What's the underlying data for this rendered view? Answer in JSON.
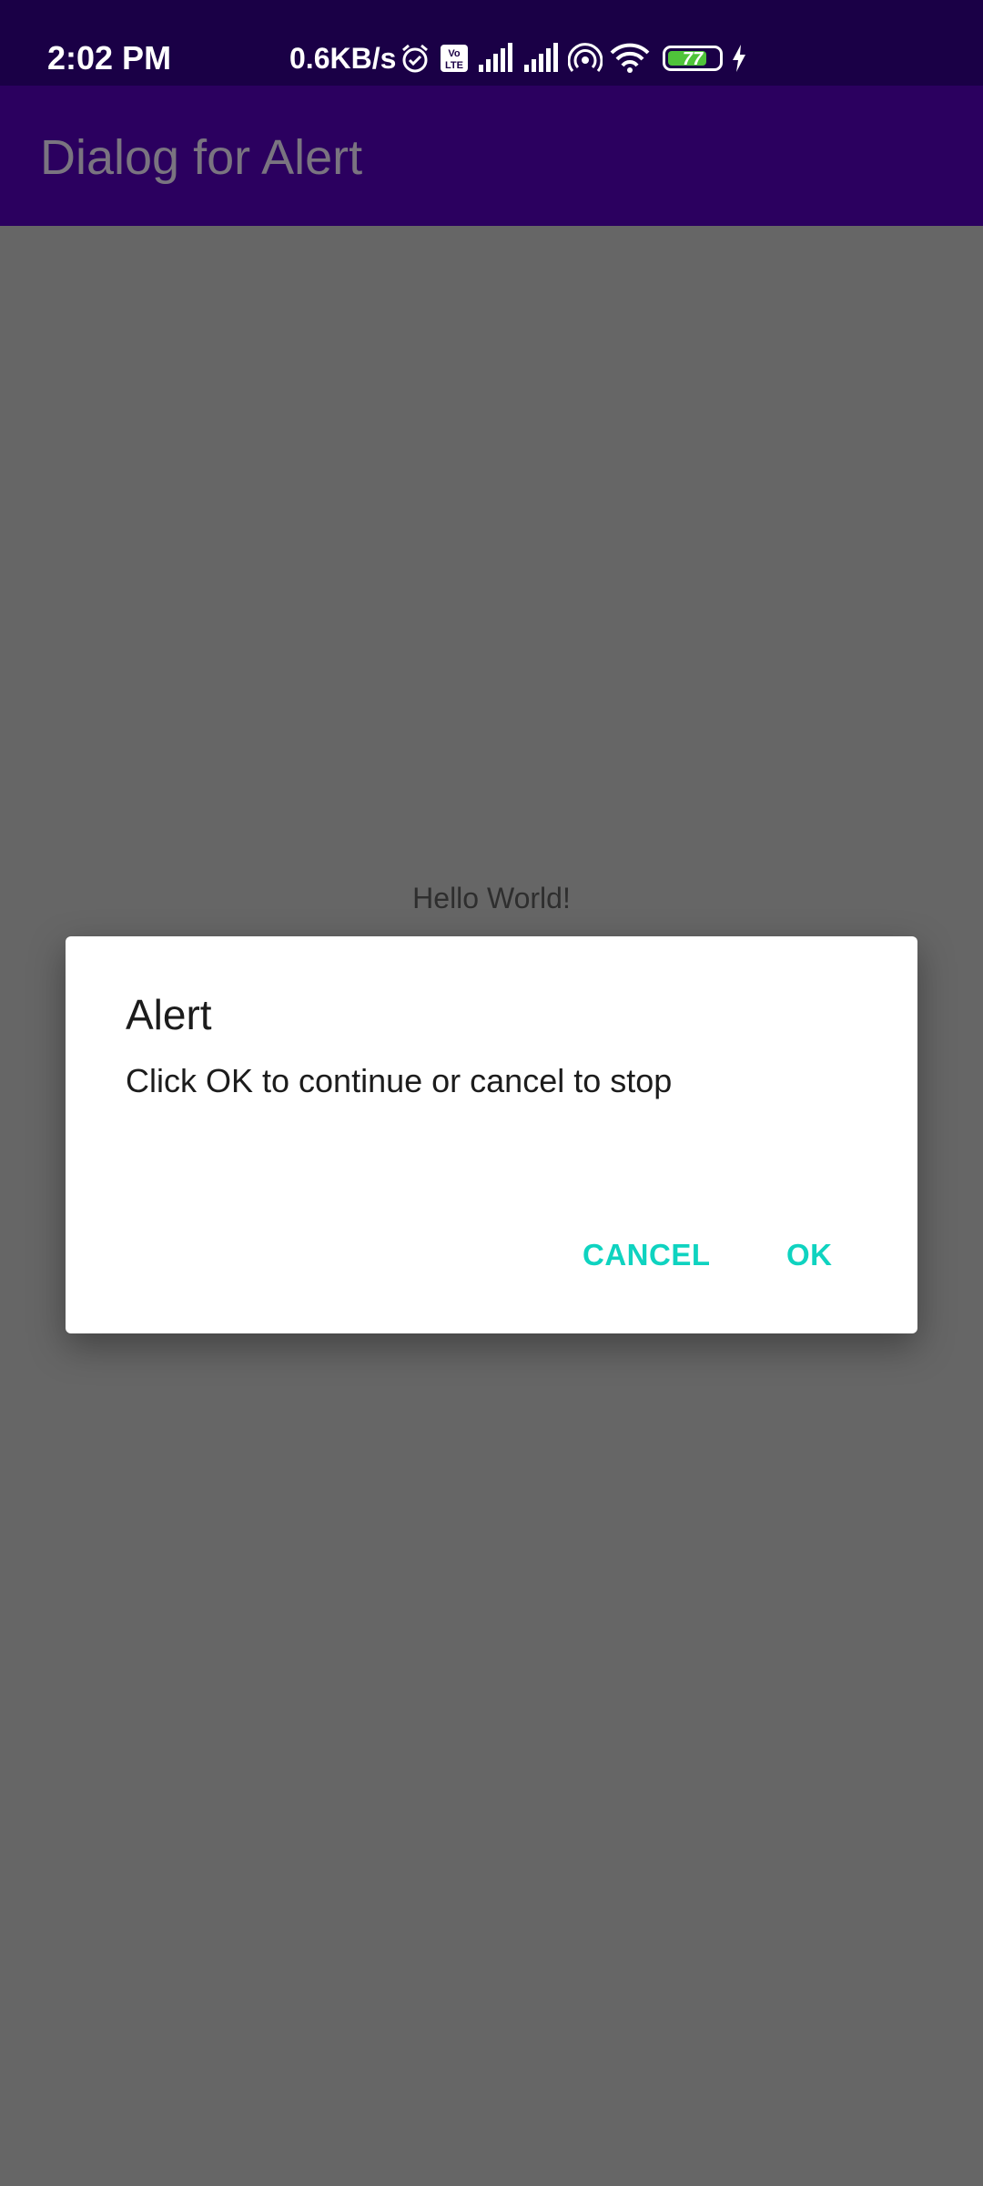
{
  "status_bar": {
    "time": "2:02 PM",
    "network_speed": "0.6KB/s",
    "icons": [
      "alarm-icon",
      "volte-icon",
      "signal-icon",
      "signal-icon",
      "hotspot-icon",
      "wifi-icon",
      "battery-icon",
      "charging-icon"
    ],
    "battery_level": "77",
    "battery_fraction": 0.77
  },
  "app_bar": {
    "title": "Dialog for Alert"
  },
  "content": {
    "hello_text": "Hello World!"
  },
  "dialog": {
    "title": "Alert",
    "message": "Click OK to continue or cancel to stop",
    "cancel_label": "CANCEL",
    "ok_label": "OK"
  },
  "colors": {
    "status_bar": "#1a0046",
    "app_bar": "#2b005f",
    "scrim_background": "#666666",
    "dialog_button": "#0fd3c0",
    "battery_fill": "#4fc43a"
  }
}
